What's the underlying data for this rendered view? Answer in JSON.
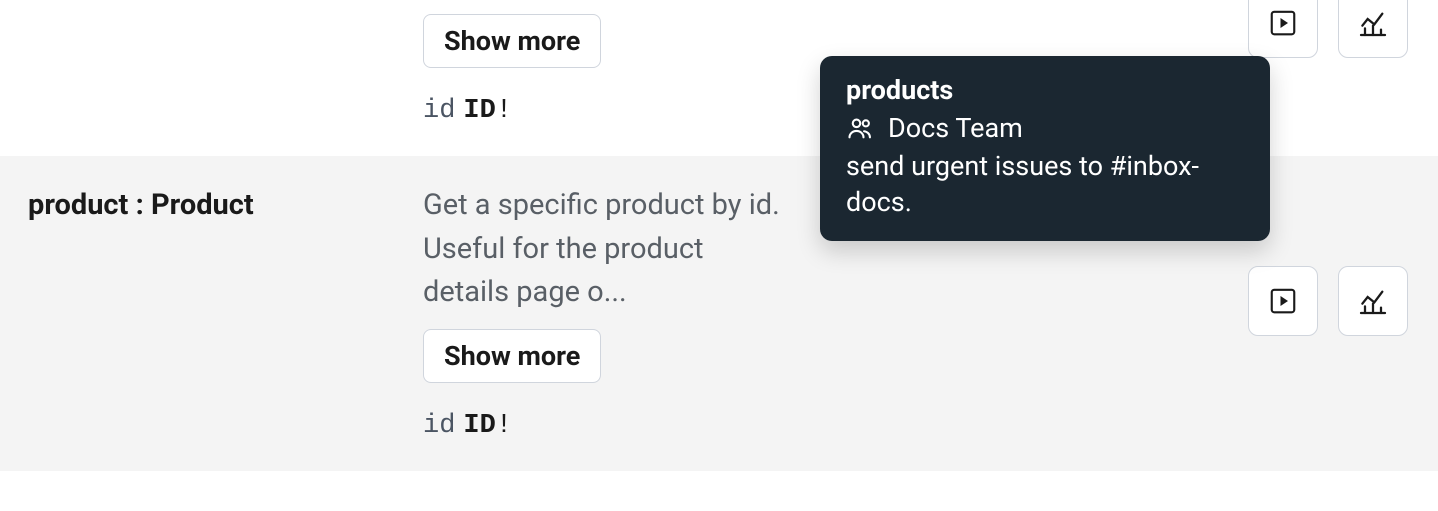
{
  "rows": [
    {
      "field": "",
      "type": "",
      "description": "",
      "show_more_label": "Show more",
      "arg_name": "id",
      "arg_type": "ID",
      "arg_required": "!",
      "tag": ""
    },
    {
      "field": "product",
      "type": "Product",
      "description": "Get a specific product by id. Useful for the product details page o...",
      "show_more_label": "Show more",
      "arg_name": "id",
      "arg_type": "ID",
      "arg_required": "!",
      "tag": "products"
    }
  ],
  "tooltip": {
    "title": "products",
    "team": "Docs Team",
    "description": "send urgent issues to #inbox-docs."
  },
  "icons": {
    "cube": "cube-icon",
    "play": "play-icon",
    "chart": "chart-icon",
    "users": "users-icon"
  }
}
